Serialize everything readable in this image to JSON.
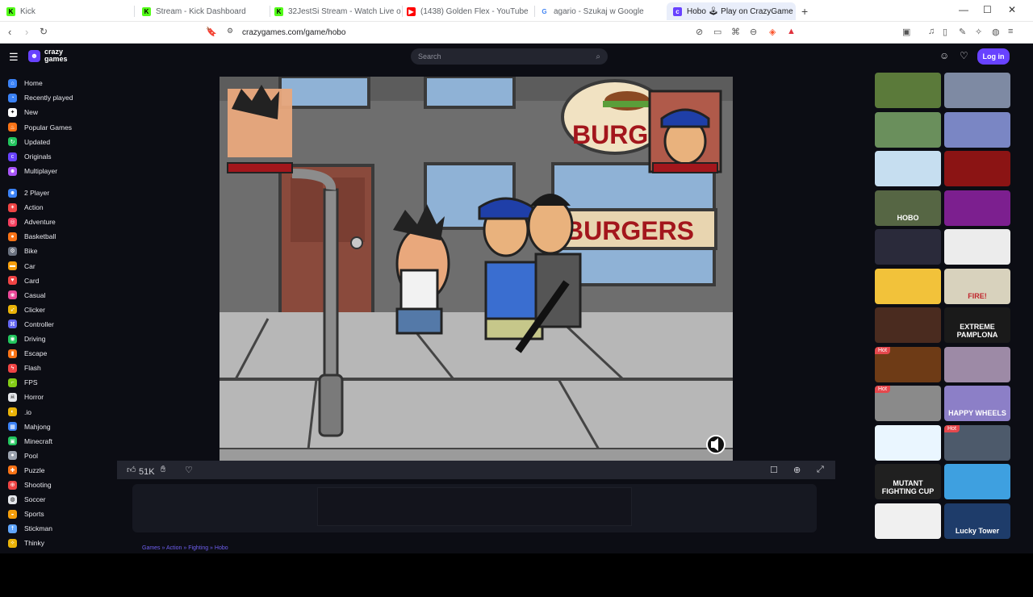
{
  "browser": {
    "tabs": [
      {
        "title": "Kick",
        "fav": "K",
        "color": "#53fc18",
        "fg": "#000"
      },
      {
        "title": "Stream - Kick Dashboard",
        "fav": "K",
        "color": "#53fc18",
        "fg": "#000"
      },
      {
        "title": "32JestSi Stream - Watch Live on Ki",
        "fav": "K",
        "color": "#53fc18",
        "fg": "#000"
      },
      {
        "title": "(1438) Golden Flex - YouTube",
        "fav": "▶",
        "color": "#ff0000",
        "fg": "#fff"
      },
      {
        "title": "agario - Szukaj w Google",
        "fav": "G",
        "color": "#ffffff",
        "fg": "#4285f4"
      },
      {
        "title": "Hobo 🕹 Play on CrazyGame",
        "fav": "c",
        "color": "#6842ff",
        "fg": "#fff"
      }
    ],
    "url": "crazygames.com/game/hobo",
    "new_tab": "+",
    "win_min": "—",
    "win_max": "☐",
    "win_close": "✕"
  },
  "site": {
    "logo_top": "crazy",
    "logo_bottom": "games",
    "search_placeholder": "Search",
    "login_label": "Log in",
    "sidebar_main": [
      {
        "label": "Home",
        "color": "#3b82f6",
        "icon": "⌂"
      },
      {
        "label": "Recently played",
        "color": "#3b82f6",
        "icon": "◔"
      },
      {
        "label": "New",
        "color": "#ffffff",
        "icon": "✦"
      },
      {
        "label": "Popular Games",
        "color": "#f97316",
        "icon": "♨"
      },
      {
        "label": "Updated",
        "color": "#22c55e",
        "icon": "↻"
      },
      {
        "label": "Originals",
        "color": "#6842ff",
        "icon": "c"
      },
      {
        "label": "Multiplayer",
        "color": "#a855f7",
        "icon": "☻"
      }
    ],
    "sidebar_categories": [
      {
        "label": "2 Player",
        "color": "#3b82f6",
        "icon": "☻"
      },
      {
        "label": "Action",
        "color": "#ef4444",
        "icon": "✶"
      },
      {
        "label": "Adventure",
        "color": "#f43f5e",
        "icon": "◎"
      },
      {
        "label": "Basketball",
        "color": "#f97316",
        "icon": "●"
      },
      {
        "label": "Bike",
        "color": "#6b7280",
        "icon": "⚙"
      },
      {
        "label": "Car",
        "color": "#f59e0b",
        "icon": "▬"
      },
      {
        "label": "Card",
        "color": "#ef4444",
        "icon": "♥"
      },
      {
        "label": "Casual",
        "color": "#ec4899",
        "icon": "❀"
      },
      {
        "label": "Clicker",
        "color": "#eab308",
        "icon": "➶"
      },
      {
        "label": "Controller",
        "color": "#6366f1",
        "icon": "⌘"
      },
      {
        "label": "Driving",
        "color": "#22c55e",
        "icon": "◉"
      },
      {
        "label": "Escape",
        "color": "#f97316",
        "icon": "▮"
      },
      {
        "label": "Flash",
        "color": "#ef4444",
        "icon": "ϟ"
      },
      {
        "label": "FPS",
        "color": "#84cc16",
        "icon": "⌐"
      },
      {
        "label": "Horror",
        "color": "#e5e7eb",
        "icon": "☠"
      },
      {
        "label": ".io",
        "color": "#eab308",
        "icon": "◐"
      },
      {
        "label": "Mahjong",
        "color": "#3b82f6",
        "icon": "▦"
      },
      {
        "label": "Minecraft",
        "color": "#22c55e",
        "icon": "▣"
      },
      {
        "label": "Pool",
        "color": "#9ca3af",
        "icon": "●"
      },
      {
        "label": "Puzzle",
        "color": "#f97316",
        "icon": "✚"
      },
      {
        "label": "Shooting",
        "color": "#ef4444",
        "icon": "⊕"
      },
      {
        "label": "Soccer",
        "color": "#e5e7eb",
        "icon": "◍"
      },
      {
        "label": "Sports",
        "color": "#f59e0b",
        "icon": "◒"
      },
      {
        "label": "Stickman",
        "color": "#60a5fa",
        "icon": "☨"
      },
      {
        "label": "Thinky",
        "color": "#eab308",
        "icon": "✧"
      }
    ],
    "likes": "51K",
    "breadcrumb": "Games » Action » Fighting » Hobo"
  },
  "game_art": {
    "sign_top": "BURG",
    "sign_main": "BURGERS"
  },
  "thumbnails": [
    {
      "bg": "#5b7a3a",
      "text": "",
      "hot": ""
    },
    {
      "bg": "#7e8aa3",
      "text": "",
      "hot": ""
    },
    {
      "bg": "#6a8f5c",
      "text": "",
      "hot": ""
    },
    {
      "bg": "#7a86c4",
      "text": "",
      "hot": ""
    },
    {
      "bg": "#c6def0",
      "text": "",
      "hot": ""
    },
    {
      "bg": "#8b1414",
      "text": "",
      "hot": ""
    },
    {
      "bg": "#566644",
      "text": "HOBO",
      "hot": ""
    },
    {
      "bg": "#7c1f8f",
      "text": "",
      "hot": ""
    },
    {
      "bg": "#2a2a3a",
      "text": "",
      "hot": ""
    },
    {
      "bg": "#ececec",
      "text": "",
      "hot": ""
    },
    {
      "bg": "#f2c23a",
      "text": "",
      "hot": ""
    },
    {
      "bg": "#d8d2bd",
      "text": "FIRE!",
      "hot": ""
    },
    {
      "bg": "#4a2b1f",
      "text": "",
      "hot": ""
    },
    {
      "bg": "#1a1a1a",
      "text": "EXTREME PAMPLONA",
      "hot": ""
    },
    {
      "bg": "#6e3b16",
      "text": "",
      "hot": "Hot"
    },
    {
      "bg": "#9d8aa6",
      "text": "",
      "hot": ""
    },
    {
      "bg": "#8a8a8a",
      "text": "",
      "hot": "Hot"
    },
    {
      "bg": "#8c7fc7",
      "text": "HAPPY WHEELS",
      "hot": ""
    },
    {
      "bg": "#eaf6ff",
      "text": "",
      "hot": ""
    },
    {
      "bg": "#4d5a6b",
      "text": "",
      "hot": "Hot"
    },
    {
      "bg": "#202020",
      "text": "MUTANT FIGHTING CUP",
      "hot": ""
    },
    {
      "bg": "#3ea0e0",
      "text": "",
      "hot": ""
    },
    {
      "bg": "#f0f0f0",
      "text": "",
      "hot": ""
    },
    {
      "bg": "#1e3c6a",
      "text": "Lucky Tower",
      "hot": ""
    }
  ]
}
